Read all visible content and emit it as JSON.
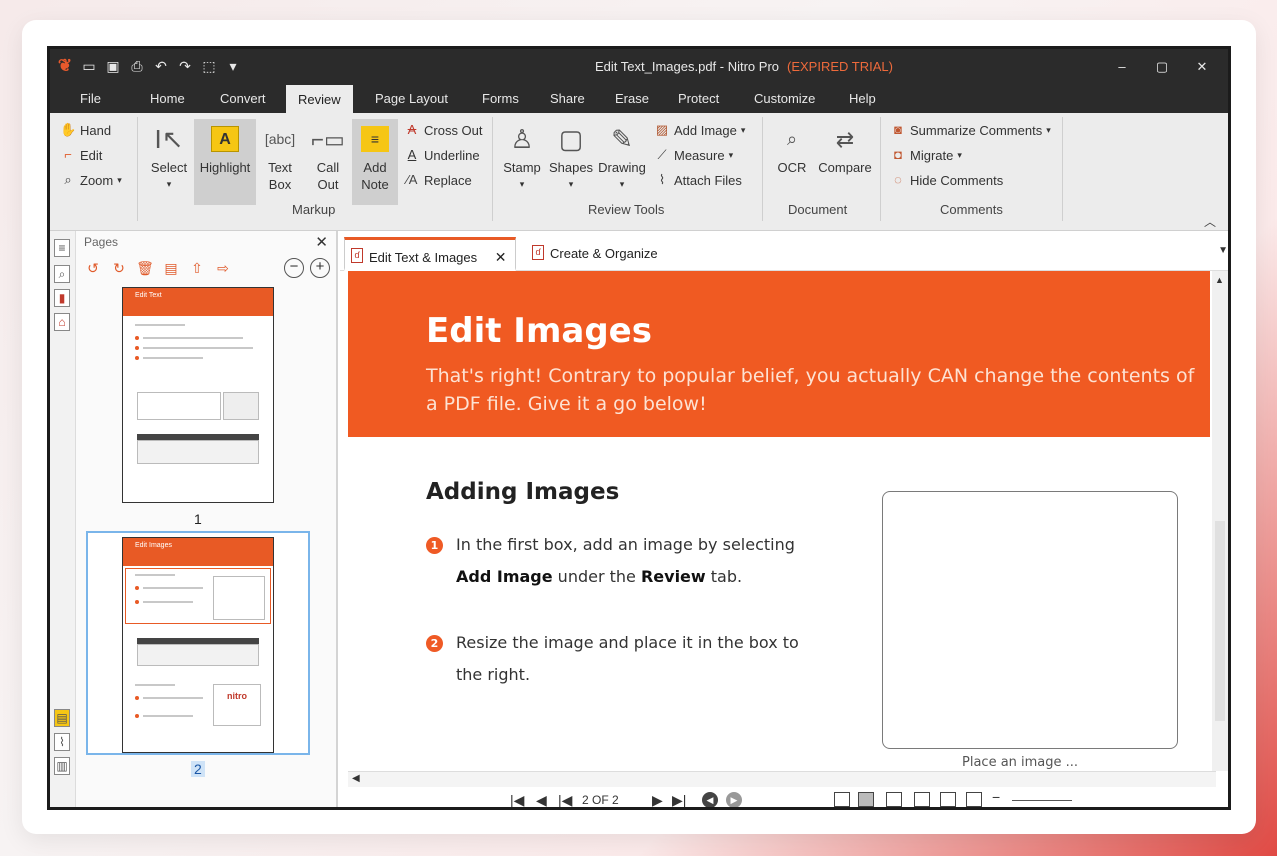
{
  "window": {
    "title": "Edit Text_Images.pdf - Nitro Pro",
    "title_status": "(EXPIRED TRIAL)",
    "controls": [
      "–",
      "▢",
      "✕"
    ]
  },
  "menu": {
    "tabs": [
      "File",
      "Home",
      "Convert",
      "Review",
      "Page Layout",
      "Forms",
      "Share",
      "Erase",
      "Protect",
      "Customize",
      "Help"
    ],
    "active": "Review"
  },
  "ribbon": {
    "nav": {
      "hand": "Hand",
      "edit": "Edit",
      "zoom": "Zoom"
    },
    "markup": {
      "select": "Select",
      "highlight": "Highlight",
      "text_box_1": "Text",
      "text_box_2": "Box",
      "call_out_1": "Call",
      "call_out_2": "Out",
      "add_note_1": "Add",
      "add_note_2": "Note",
      "cross_out": "Cross Out",
      "underline": "Underline",
      "replace": "Replace",
      "group_label": "Markup"
    },
    "review_tools": {
      "stamp": "Stamp",
      "shapes": "Shapes",
      "drawing": "Drawing",
      "add_image": "Add Image",
      "measure": "Measure",
      "attach_files": "Attach Files",
      "group_label": "Review Tools"
    },
    "document": {
      "ocr": "OCR",
      "compare": "Compare",
      "group_label": "Document"
    },
    "comments": {
      "summarize": "Summarize Comments",
      "migrate": "Migrate",
      "hide": "Hide Comments",
      "group_label": "Comments"
    }
  },
  "pages_panel": {
    "title": "Pages",
    "page_numbers": [
      "1",
      "2"
    ],
    "thumb_titles": [
      "Edit Text",
      "Edit Images"
    ],
    "thumb_logo": "nitro"
  },
  "doc_tabs": [
    {
      "label": "Edit Text & Images",
      "close": "✕"
    },
    {
      "label": "Create & Organize"
    }
  ],
  "document": {
    "banner_title": "Edit Images",
    "banner_subtitle": "That's right! Contrary to popular belief, you actually CAN change the contents of a PDF file. Give it a go below!",
    "heading": "Adding Images",
    "step1_num": "1",
    "step1_a": "In the first box, add an image by selecting ",
    "step1_b": "Add Image",
    "step1_c": " under the ",
    "step1_d": "Review",
    "step1_e": " tab.",
    "step2_num": "2",
    "step2": "Resize the image and place it in the box to the right.",
    "box_caption": "Place an image ..."
  },
  "status": {
    "page_indicator": "2 OF 2"
  },
  "colors": {
    "accent": "#f05a22",
    "titlebar": "#2b2b2b",
    "ribbon": "#ececec",
    "highlight_yellow": "#f6c614"
  }
}
